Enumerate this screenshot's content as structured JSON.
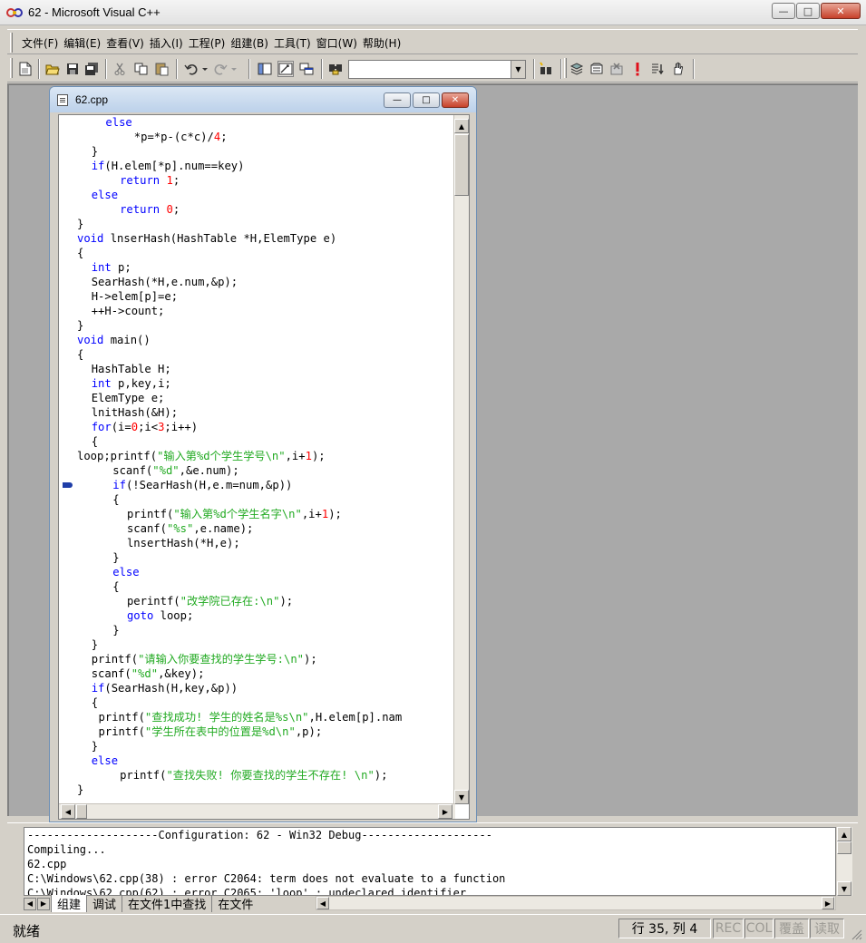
{
  "window": {
    "title": "62 - Microsoft Visual C++",
    "minimize": "—",
    "maximize": "□",
    "close": "✕"
  },
  "menu": [
    "文件(F)",
    "编辑(E)",
    "查看(V)",
    "插入(I)",
    "工程(P)",
    "组建(B)",
    "工具(T)",
    "窗口(W)",
    "帮助(H)"
  ],
  "toolbar": {
    "combo_value": ""
  },
  "doc": {
    "title": "62.cpp",
    "minimize": "—",
    "maximize": "□",
    "close": "✕"
  },
  "code": [
    {
      "i": 4,
      "parts": [
        [
          "kw",
          "else"
        ]
      ]
    },
    {
      "i": 8,
      "parts": [
        [
          "t",
          "*p=*p-(c*c)/"
        ],
        [
          "num",
          "4"
        ],
        [
          "t",
          ";"
        ]
      ]
    },
    {
      "i": 2,
      "parts": [
        [
          "t",
          "}"
        ]
      ]
    },
    {
      "i": 2,
      "parts": [
        [
          "kw",
          "if"
        ],
        [
          "t",
          "(H.elem[*p].num==key)"
        ]
      ]
    },
    {
      "i": 6,
      "parts": [
        [
          "kw",
          "return"
        ],
        [
          "t",
          " "
        ],
        [
          "num",
          "1"
        ],
        [
          "t",
          ";"
        ]
      ]
    },
    {
      "i": 2,
      "parts": [
        [
          "kw",
          "else"
        ]
      ]
    },
    {
      "i": 6,
      "parts": [
        [
          "kw",
          "return"
        ],
        [
          "t",
          " "
        ],
        [
          "num",
          "0"
        ],
        [
          "t",
          ";"
        ]
      ]
    },
    {
      "i": 0,
      "parts": [
        [
          "t",
          "}"
        ]
      ]
    },
    {
      "i": 0,
      "parts": [
        [
          "kw",
          "void"
        ],
        [
          "t",
          " lnserHash(HashTable *H,ElemType e)"
        ]
      ]
    },
    {
      "i": 0,
      "parts": [
        [
          "t",
          "{"
        ]
      ]
    },
    {
      "i": 2,
      "parts": [
        [
          "kw",
          "int"
        ],
        [
          "t",
          " p;"
        ]
      ]
    },
    {
      "i": 2,
      "parts": [
        [
          "t",
          "SearHash(*H,e.num,&p);"
        ]
      ]
    },
    {
      "i": 2,
      "parts": [
        [
          "t",
          "H->elem[p]=e;"
        ]
      ]
    },
    {
      "i": 2,
      "parts": [
        [
          "t",
          "++H->count;"
        ]
      ]
    },
    {
      "i": 0,
      "parts": [
        [
          "t",
          "}"
        ]
      ]
    },
    {
      "i": 0,
      "parts": [
        [
          "kw",
          "void"
        ],
        [
          "t",
          " main()"
        ]
      ]
    },
    {
      "i": 0,
      "parts": [
        [
          "t",
          "{"
        ]
      ]
    },
    {
      "i": 2,
      "parts": [
        [
          "t",
          "HashTable H;"
        ]
      ]
    },
    {
      "i": 2,
      "parts": [
        [
          "kw",
          "int"
        ],
        [
          "t",
          " p,key,i;"
        ]
      ]
    },
    {
      "i": 2,
      "parts": [
        [
          "t",
          "ElemType e;"
        ]
      ]
    },
    {
      "i": 2,
      "parts": [
        [
          "t",
          "lnitHash(&H);"
        ]
      ]
    },
    {
      "i": 2,
      "parts": [
        [
          "kw",
          "for"
        ],
        [
          "t",
          "(i="
        ],
        [
          "num",
          "0"
        ],
        [
          "t",
          ";i<"
        ],
        [
          "num",
          "3"
        ],
        [
          "t",
          ";i++)"
        ]
      ]
    },
    {
      "i": 2,
      "parts": [
        [
          "t",
          "{"
        ]
      ]
    },
    {
      "i": 0,
      "parts": [
        [
          "t",
          "loop;printf("
        ],
        [
          "str",
          "\"输入第%d个学生学号\\n\""
        ],
        [
          "t",
          ",i+"
        ],
        [
          "num",
          "1"
        ],
        [
          "t",
          ");"
        ]
      ]
    },
    {
      "i": 5,
      "parts": [
        [
          "t",
          "scanf("
        ],
        [
          "str",
          "\"%d\""
        ],
        [
          "t",
          ",&e.num);"
        ]
      ]
    },
    {
      "i": 5,
      "parts": [
        [
          "kw",
          "if"
        ],
        [
          "t",
          "(!SearHash(H,e.m=num,&p))"
        ]
      ],
      "marker": true
    },
    {
      "i": 5,
      "parts": [
        [
          "t",
          "{"
        ]
      ]
    },
    {
      "i": 7,
      "parts": [
        [
          "t",
          "printf("
        ],
        [
          "str",
          "\"输入第%d个学生名字\\n\""
        ],
        [
          "t",
          ",i+"
        ],
        [
          "num",
          "1"
        ],
        [
          "t",
          ");"
        ]
      ]
    },
    {
      "i": 7,
      "parts": [
        [
          "t",
          "scanf("
        ],
        [
          "str",
          "\"%s\""
        ],
        [
          "t",
          ",e.name);"
        ]
      ]
    },
    {
      "i": 7,
      "parts": [
        [
          "t",
          "lnsertHash(*H,e);"
        ]
      ]
    },
    {
      "i": 5,
      "parts": [
        [
          "t",
          "}"
        ]
      ]
    },
    {
      "i": 5,
      "parts": [
        [
          "kw",
          "else"
        ]
      ]
    },
    {
      "i": 5,
      "parts": [
        [
          "t",
          "{"
        ]
      ]
    },
    {
      "i": 7,
      "parts": [
        [
          "t",
          "perintf("
        ],
        [
          "str",
          "\"改学院已存在:\\n\""
        ],
        [
          "t",
          ");"
        ]
      ]
    },
    {
      "i": 7,
      "parts": [
        [
          "kw",
          "goto"
        ],
        [
          "t",
          " loop;"
        ]
      ]
    },
    {
      "i": 5,
      "parts": [
        [
          "t",
          "}"
        ]
      ]
    },
    {
      "i": 2,
      "parts": [
        [
          "t",
          "}"
        ]
      ]
    },
    {
      "i": 2,
      "parts": [
        [
          "t",
          "printf("
        ],
        [
          "str",
          "\"请输入你要查找的学生学号:\\n\""
        ],
        [
          "t",
          ");"
        ]
      ]
    },
    {
      "i": 2,
      "parts": [
        [
          "t",
          "scanf("
        ],
        [
          "str",
          "\"%d\""
        ],
        [
          "t",
          ",&key);"
        ]
      ]
    },
    {
      "i": 2,
      "parts": [
        [
          "kw",
          "if"
        ],
        [
          "t",
          "(SearHash(H,key,&p))"
        ]
      ]
    },
    {
      "i": 2,
      "parts": [
        [
          "t",
          "{"
        ]
      ]
    },
    {
      "i": 3,
      "parts": [
        [
          "t",
          "printf("
        ],
        [
          "str",
          "\"查找成功! 学生的姓名是%s\\n\""
        ],
        [
          "t",
          ",H.elem[p].nam"
        ]
      ]
    },
    {
      "i": 3,
      "parts": [
        [
          "t",
          "printf("
        ],
        [
          "str",
          "\"学生所在表中的位置是%d\\n\""
        ],
        [
          "t",
          ",p);"
        ]
      ]
    },
    {
      "i": 2,
      "parts": [
        [
          "t",
          "}"
        ]
      ]
    },
    {
      "i": 2,
      "parts": [
        [
          "kw",
          "else"
        ]
      ]
    },
    {
      "i": 6,
      "parts": [
        [
          "t",
          "printf("
        ],
        [
          "str",
          "\"查找失败! 你要查找的学生不存在! \\n\""
        ],
        [
          "t",
          ");"
        ]
      ]
    },
    {
      "i": 0,
      "parts": [
        [
          "t",
          "}"
        ]
      ]
    }
  ],
  "output": {
    "lines": [
      "--------------------Configuration: 62 - Win32 Debug--------------------",
      "Compiling...",
      "62.cpp",
      "C:\\Windows\\62.cpp(38) : error C2064: term does not evaluate to a function",
      "C:\\Windows\\62.cpp(62) : error C2065: 'loop' : undeclared identifier"
    ],
    "tabs": [
      "组建",
      "调试",
      "在文件1中查找",
      "在文件"
    ]
  },
  "status": {
    "main": "就绪",
    "position": "行 35, 列 4",
    "rec": "REC",
    "col": "COL",
    "ovr": "覆盖",
    "read": "读取"
  }
}
